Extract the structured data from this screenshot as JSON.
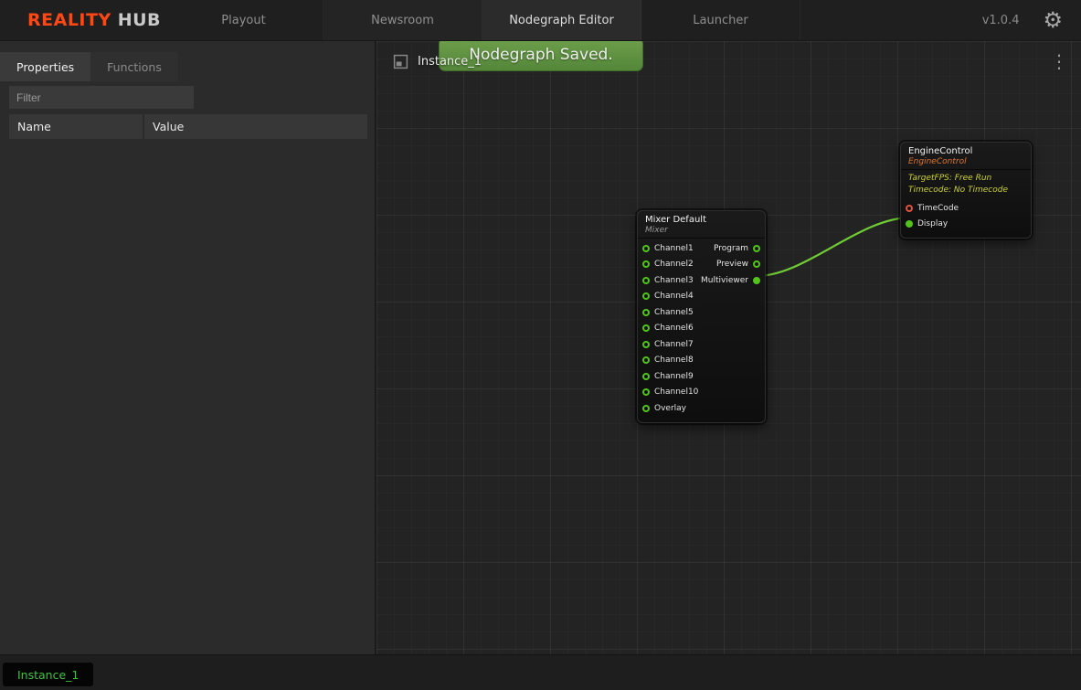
{
  "app": {
    "logo_primary": "REALITY",
    "logo_secondary": "HUB",
    "version": "v1.0.4"
  },
  "topbar": {
    "tabs": [
      {
        "label": "Playout",
        "active": false
      },
      {
        "label": "Newsroom",
        "active": false
      },
      {
        "label": "Nodegraph Editor",
        "active": true
      },
      {
        "label": "Launcher",
        "active": false
      }
    ]
  },
  "sidebar": {
    "tabs": [
      {
        "label": "Properties",
        "active": true
      },
      {
        "label": "Functions",
        "active": false
      }
    ],
    "filter_placeholder": "Filter",
    "table": {
      "columns": [
        "Name",
        "Value"
      ],
      "rows": []
    }
  },
  "canvas": {
    "instance_label": "Instance_1",
    "toast": "Nodegraph Saved.",
    "nodes": {
      "mixer": {
        "title": "Mixer Default",
        "subtitle": "Mixer",
        "inputs": [
          "Channel1",
          "Channel2",
          "Channel3",
          "Channel4",
          "Channel5",
          "Channel6",
          "Channel7",
          "Channel8",
          "Channel9",
          "Channel10",
          "Overlay"
        ],
        "outputs": [
          {
            "label": "Program",
            "connected": false
          },
          {
            "label": "Preview",
            "connected": false
          },
          {
            "label": "Multiviewer",
            "connected": true
          }
        ]
      },
      "engine_control": {
        "title": "EngineControl",
        "subtitle": "EngineControl",
        "info_lines": [
          "TargetFPS: Free Run",
          "Timecode: No Timecode"
        ],
        "inputs": [
          {
            "label": "TimeCode",
            "connected": false,
            "color": "#e05340"
          },
          {
            "label": "Display",
            "connected": true,
            "color": "#52c41a"
          }
        ]
      }
    },
    "connections": [
      {
        "from": "Mixer Default.Multiviewer",
        "to": "EngineControl.Display",
        "color": "#6fce33"
      }
    ]
  },
  "statusbar": {
    "instance_tab": "Instance_1"
  },
  "colors": {
    "accent_orange": "#ff4713",
    "pin_green": "#52c41a",
    "pin_red": "#e05340",
    "wire_green": "#6fce33",
    "toast_green": "#639a42"
  }
}
